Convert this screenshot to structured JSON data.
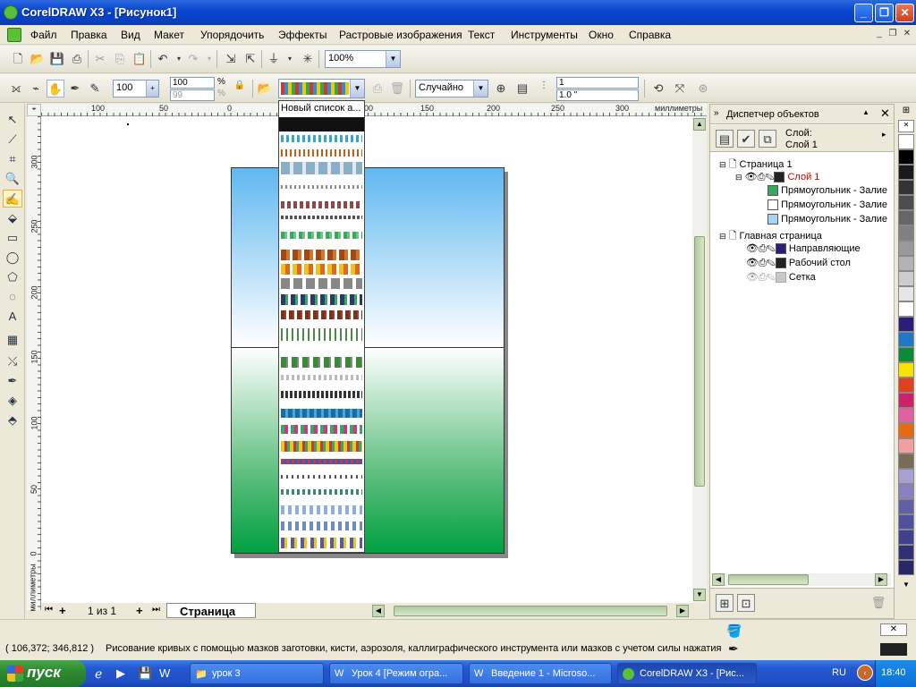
{
  "window": {
    "title": "CorelDRAW X3 - [Рисунок1]"
  },
  "menu": [
    "Файл",
    "Правка",
    "Вид",
    "Макет",
    "Упорядочить",
    "Эффекты",
    "Растровые изображения",
    "Текст",
    "Инструменты",
    "Окно",
    "Справка"
  ],
  "toolbar1": {
    "zoom_value": "100%"
  },
  "toolbar2": {
    "size_value": "100",
    "spin1": "100",
    "spin2": "99",
    "percent": "%",
    "brush_list_value": "Новый список а...",
    "mode_value": "Случайно",
    "count_value": "1",
    "offset_value": "1.0 \""
  },
  "ruler": {
    "unit": "миллиметры",
    "h_ticks": [
      "100",
      "50",
      "0",
      "50",
      "100",
      "150",
      "200",
      "250",
      "300"
    ],
    "v_ticks": [
      "300",
      "250",
      "200",
      "150",
      "100",
      "50",
      "0"
    ],
    "v_unit": "миллиметры"
  },
  "page_nav": {
    "pages": "1 из 1",
    "tab": "Страница 1"
  },
  "docker": {
    "title": "Диспетчер объектов",
    "layer_label": "Слой:",
    "layer_name": "Слой 1",
    "tree": [
      {
        "label": "Страница 1",
        "color": "",
        "level": 0
      },
      {
        "label": "Слой 1",
        "color": "#222222",
        "level": 1,
        "highlight": true
      },
      {
        "label": "Прямоугольник - Залие",
        "color": "#3aa860",
        "level": 2
      },
      {
        "label": "Прямоугольник - Залие",
        "color": "#ffffff",
        "level": 2
      },
      {
        "label": "Прямоугольник - Залие",
        "color": "#a8d4f4",
        "level": 2
      },
      {
        "label": "Главная страница",
        "color": "",
        "level": 0
      },
      {
        "label": "Направляющие",
        "color": "#2a1e7a",
        "level": 1
      },
      {
        "label": "Рабочий стол",
        "color": "#222222",
        "level": 1
      },
      {
        "label": "Сетка",
        "color": "#c8c8c8",
        "level": 1
      }
    ]
  },
  "palette": [
    "#ffffff",
    "#000000",
    "#1a1a1a",
    "#333333",
    "#4d4d4d",
    "#666666",
    "#808080",
    "#999999",
    "#b3b3b3",
    "#cccccc",
    "#e6e6e6",
    "#ffffff",
    "#2a1e7a",
    "#1e78c8",
    "#0a8a3a",
    "#f4e400",
    "#e04020",
    "#d0206a",
    "#e060a0",
    "#e86a10",
    "#f0a0a0",
    "#7a6a58",
    "#a8a0d0",
    "#8880c0",
    "#6060a8",
    "#5050a0",
    "#404090",
    "#303078",
    "#282868"
  ],
  "status": {
    "coords": "( 106,372; 346,812 )",
    "message": "Рисование кривых с помощью мазков заготовки, кисти, аэрозоля, каллиграфического инструмента или мазков с учетом силы нажатия"
  },
  "taskbar": {
    "start_label": "пуск",
    "tasks": [
      "урок 3",
      "Урок 4 [Режим огра...",
      "Введение 1 - Microso...",
      "CorelDRAW X3 - [Рис..."
    ],
    "lang": "RU",
    "time": "18:40"
  }
}
